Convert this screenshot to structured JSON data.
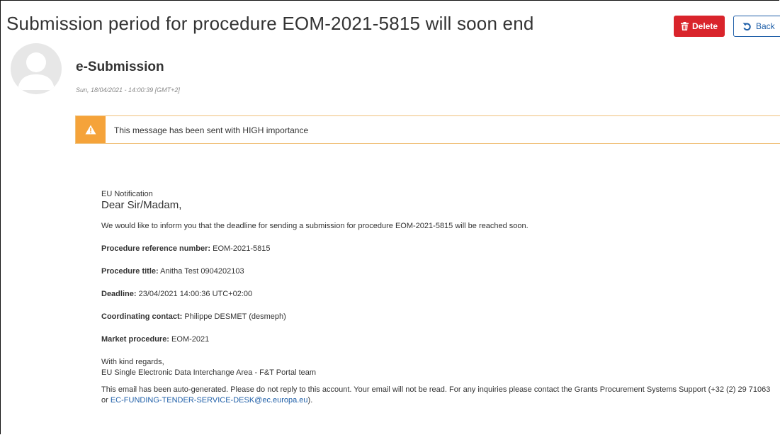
{
  "header": {
    "title": "Submission period for procedure EOM-2021-5815 will soon end",
    "delete_label": "Delete",
    "back_label": "Back"
  },
  "message": {
    "sender": "e-Submission",
    "date": "Sun, 18/04/2021 - 14:00:39 [GMT+2]",
    "alert": "This message has been sent with HIGH importance"
  },
  "body": {
    "notification": "EU Notification",
    "greeting": "Dear Sir/Madam,",
    "intro": "We would like to inform you that the deadline for sending a submission for procedure EOM-2021-5815 will be reached soon.",
    "fields": [
      {
        "label": "Procedure reference number:",
        "value": "EOM-2021-5815"
      },
      {
        "label": "Procedure title:",
        "value": "Anitha Test 0904202103"
      },
      {
        "label": "Deadline:",
        "value": "23/04/2021 14:00:36 UTC+02:00"
      },
      {
        "label": "Coordinating contact:",
        "value": "Philippe DESMET (desmeph)"
      },
      {
        "label": "Market procedure:",
        "value": "EOM-2021"
      }
    ],
    "regards_line1": "With kind regards,",
    "regards_line2": "EU Single Electronic Data Interchange Area - F&T Portal team",
    "footer_text": "This email has been auto-generated. Please do not reply to this account. Your email will not be read. For any inquiries please contact the Grants Procurement Systems Support (+32 (2) 29 71063 or",
    "footer_email": "EC-FUNDING-TENDER-SERVICE-DESK@ec.europa.eu",
    "footer_end": ")."
  },
  "colors": {
    "delete_bg": "#d9242b",
    "back_border": "#1f5fa8",
    "alert_accent": "#f5a33a",
    "link": "#1f5fa8"
  },
  "icons": {
    "delete": "trash-icon",
    "back": "undo-arrow-icon",
    "avatar": "user-silhouette-icon",
    "alert": "warning-icon"
  }
}
